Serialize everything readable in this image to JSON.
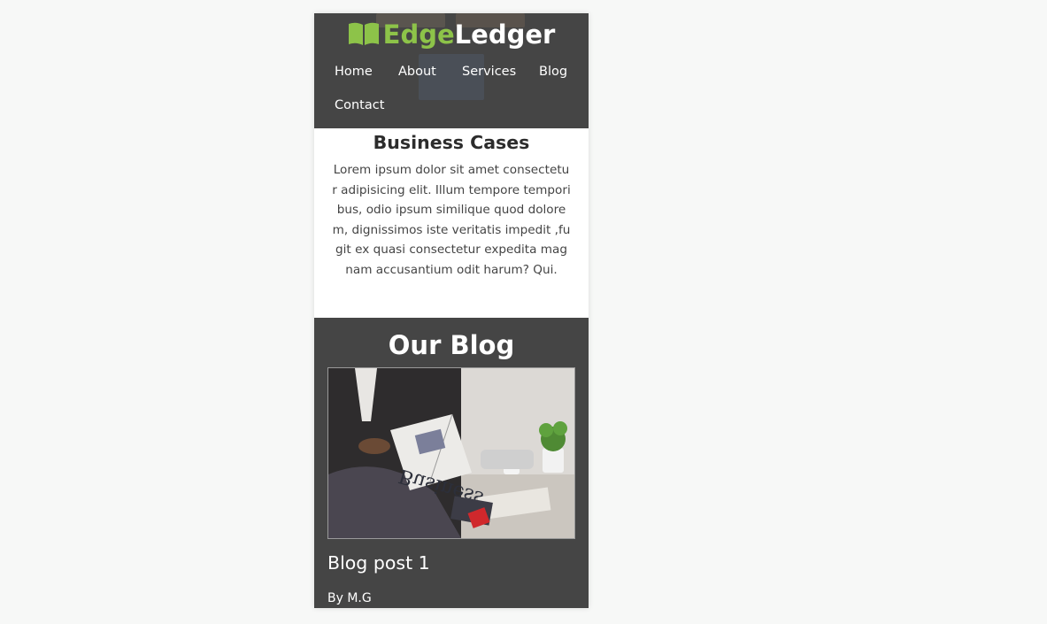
{
  "logo": {
    "part1": "Edge",
    "part2": "Ledger",
    "icon": "book-icon",
    "accent_color": "#8dc349"
  },
  "nav": {
    "items": [
      {
        "label": "Home"
      },
      {
        "label": "About"
      },
      {
        "label": "Services"
      },
      {
        "label": "Blog"
      },
      {
        "label": "Contact"
      }
    ]
  },
  "cases": {
    "heading": "Business Cases",
    "body": "Lorem ipsum dolor sit amet consectetur adipisicing elit. Illum tempore temporibus, odio ipsum similique quod dolorem, dignissimos iste veritatis  impedit ,fugit ex quasi consectetur expedita magnam accusantium odit harum? Qui."
  },
  "blog": {
    "heading": "Our Blog",
    "posts": [
      {
        "title": "Blog post 1",
        "author": "By M.G",
        "photo_newspaper_text": "Business"
      }
    ]
  },
  "colors": {
    "header_bg": "#454545",
    "blog_bg": "#454545",
    "page_bg": "#f7f8f7"
  }
}
